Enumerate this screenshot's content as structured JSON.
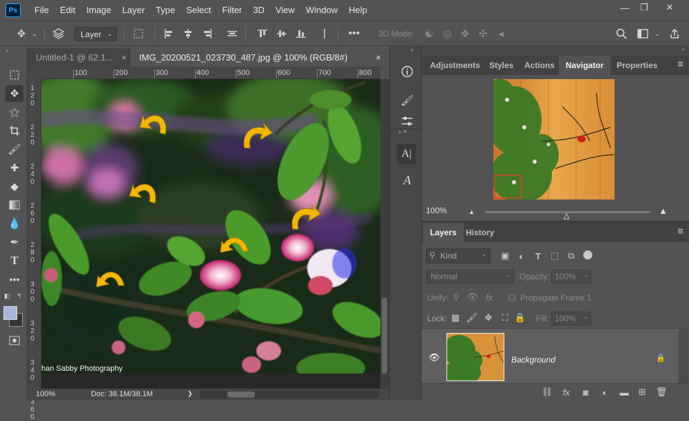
{
  "app": {
    "logo": "Ps"
  },
  "menu": [
    "File",
    "Edit",
    "Image",
    "Layer",
    "Type",
    "Select",
    "Filter",
    "3D",
    "View",
    "Window",
    "Help"
  ],
  "window_controls": {
    "minimize": "—",
    "restore": "❐",
    "close": "✕"
  },
  "options_bar": {
    "layer_dropdown": "Layer",
    "mode_label": "3D Mode:"
  },
  "tabs": [
    {
      "title": "Untitled-1 @ 62.1...",
      "close": "×"
    },
    {
      "title": "IMG_20200521_023730_487.jpg @ 100% (RGB/8#)",
      "close": "×"
    }
  ],
  "ruler": {
    "top": [
      "100",
      "200",
      "300",
      "400",
      "500",
      "600",
      "700",
      "800"
    ],
    "left": [
      "1",
      "2",
      "0",
      "2",
      "2",
      "0",
      "2",
      "4",
      "0",
      "2",
      "6",
      "0",
      "2",
      "8",
      "0",
      "3",
      "0",
      "0",
      "3",
      "2",
      "0",
      "3",
      "4",
      "0",
      "3",
      "6",
      "0"
    ]
  },
  "watermark": "han Sabby Photography",
  "status": {
    "zoom": "100%",
    "doc": "Doc: 38.1M/38.1M",
    "arrow": "❯"
  },
  "top_panel": {
    "tabs": [
      "Adjustments",
      "Styles",
      "Actions",
      "Navigator",
      "Properties"
    ],
    "active_tab": "Navigator",
    "menu_icon": "≡",
    "zoom": "100%"
  },
  "layers_panel": {
    "tabs": [
      "Layers",
      "History"
    ],
    "active_tab": "Layers",
    "menu_icon": "≡",
    "kind_label": "Kind",
    "blend_mode": "Normal",
    "opacity_label": "Opacity:",
    "opacity_value": "100%",
    "unify_label": "Unify:",
    "propagate_label": "Propagate Frame 1",
    "lock_label": "Lock:",
    "fill_label": "Fill:",
    "fill_value": "100%",
    "layer": {
      "name": "Background",
      "visible": true,
      "locked": true
    }
  },
  "colors": {
    "accent_arrow": "#f2b705",
    "bg": "#535353",
    "panel_dark": "#454545"
  }
}
